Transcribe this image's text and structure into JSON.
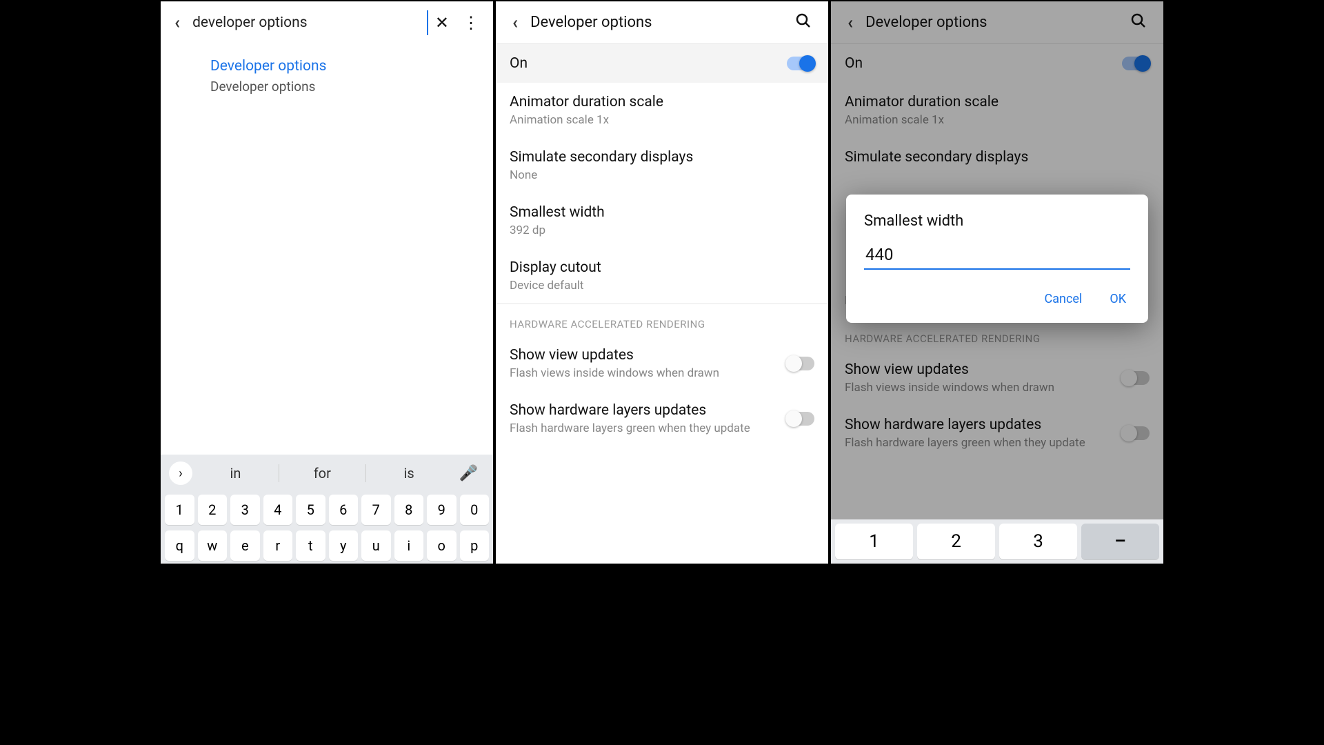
{
  "panel1": {
    "search_value": "developer options",
    "result_title": "Developer options",
    "result_sub": "Developer options",
    "suggestions": [
      "in",
      "for",
      "is"
    ],
    "numrow": [
      "1",
      "2",
      "3",
      "4",
      "5",
      "6",
      "7",
      "8",
      "9",
      "0"
    ],
    "qrow": [
      "q",
      "w",
      "e",
      "r",
      "t",
      "y",
      "u",
      "i",
      "o",
      "p"
    ]
  },
  "panel2": {
    "title": "Developer options",
    "on_label": "On",
    "items": [
      {
        "title": "Animator duration scale",
        "sub": "Animation scale 1x"
      },
      {
        "title": "Simulate secondary displays",
        "sub": "None"
      },
      {
        "title": "Smallest width",
        "sub": "392 dp"
      },
      {
        "title": "Display cutout",
        "sub": "Device default"
      }
    ],
    "section": "HARDWARE ACCELERATED RENDERING",
    "hw": [
      {
        "title": "Show view updates",
        "sub": "Flash views inside windows when drawn"
      },
      {
        "title": "Show hardware layers updates",
        "sub": "Flash hardware layers green when they update"
      }
    ]
  },
  "panel3": {
    "title": "Developer options",
    "on_label": "On",
    "dialog_title": "Smallest width",
    "dialog_value": "440",
    "cancel": "Cancel",
    "ok": "OK",
    "numkeys": [
      "1",
      "2",
      "3",
      "–"
    ]
  }
}
